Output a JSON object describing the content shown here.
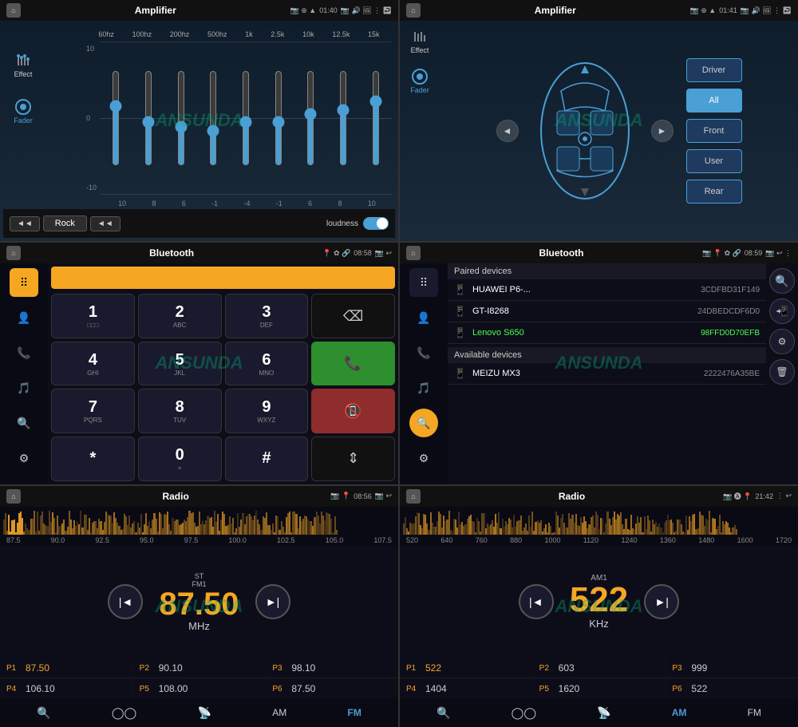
{
  "panels": {
    "eq": {
      "title": "Amplifier",
      "time": "01:40",
      "sidebar": {
        "effect_label": "Effect",
        "fader_label": "Fader"
      },
      "freq_labels": [
        "60hz",
        "100hz",
        "200hz",
        "500hz",
        "1k",
        "2.5k",
        "10k",
        "12.5k",
        "15k"
      ],
      "y_labels": [
        "10",
        "0",
        "-10"
      ],
      "x_labels": [
        "10",
        "8",
        "6",
        "-1",
        "-4",
        "-1",
        "6",
        "8",
        "10"
      ],
      "slider_values": [
        65,
        55,
        50,
        45,
        50,
        50,
        55,
        60,
        70
      ],
      "preset": "Rock",
      "loudness_label": "loudness",
      "prev_btn": "◄◄",
      "next_btn": "◄◄"
    },
    "fader": {
      "title": "Amplifier",
      "time": "01:41",
      "sidebar": {
        "effect_label": "Effect",
        "fader_label": "Fader"
      },
      "buttons": [
        "Driver",
        "All",
        "Front",
        "User",
        "Rear"
      ],
      "active_button": "All"
    },
    "bt_dialer": {
      "title": "Bluetooth",
      "time": "08:58",
      "keys": [
        {
          "num": "1",
          "alpha": "□□□"
        },
        {
          "num": "2",
          "alpha": "ABC"
        },
        {
          "num": "3",
          "alpha": "DEF"
        },
        {
          "num": "⌫",
          "alpha": "",
          "type": "dark"
        },
        {
          "num": "4",
          "alpha": "GHI"
        },
        {
          "num": "5",
          "alpha": "JKL"
        },
        {
          "num": "6",
          "alpha": "MNO"
        },
        {
          "num": "📞",
          "alpha": "",
          "type": "green"
        },
        {
          "num": "7",
          "alpha": "PQRS"
        },
        {
          "num": "8",
          "alpha": "TUV"
        },
        {
          "num": "9",
          "alpha": "WXYZ"
        },
        {
          "num": "📵",
          "alpha": "",
          "type": "red"
        },
        {
          "num": "*",
          "alpha": ""
        },
        {
          "num": "0",
          "alpha": "+"
        },
        {
          "num": "#",
          "alpha": ""
        },
        {
          "num": "⇕",
          "alpha": "",
          "type": "dark"
        }
      ]
    },
    "bt_devices": {
      "title": "Bluetooth",
      "time": "08:59",
      "paired_title": "Paired devices",
      "available_title": "Available devices",
      "paired": [
        {
          "name": "HUAWEI P6-...",
          "addr": "3CDFBD31F149",
          "highlight": false
        },
        {
          "name": "GT-I8268",
          "addr": "24DBEDCDF6D0",
          "highlight": false
        },
        {
          "name": "Lenovo S650",
          "addr": "98FFD0D70EFB",
          "highlight": true
        }
      ],
      "available": [
        {
          "name": "MEIZU MX3",
          "addr": "2222476A35BE",
          "highlight": false
        }
      ]
    },
    "radio_fm": {
      "title": "Radio",
      "time": "08:56",
      "band": "ST\nFM1",
      "freq": "87.50",
      "unit": "MHz",
      "scale_labels": [
        "87.5",
        "90.0",
        "92.5",
        "95.0",
        "97.5",
        "100.0",
        "102.5",
        "105.0",
        "107.5"
      ],
      "presets": [
        {
          "label": "P1",
          "freq": "87.50",
          "highlight": true
        },
        {
          "label": "P2",
          "freq": "90.10",
          "highlight": false
        },
        {
          "label": "P3",
          "freq": "98.10",
          "highlight": false
        },
        {
          "label": "P4",
          "freq": "106.10",
          "highlight": false
        },
        {
          "label": "P5",
          "freq": "108.00",
          "highlight": false
        },
        {
          "label": "P6",
          "freq": "87.50",
          "highlight": false
        }
      ],
      "bottom_btns": [
        "◎",
        "○○",
        "(•)",
        "AM",
        "FM"
      ]
    },
    "radio_am": {
      "title": "Radio",
      "time": "21:42",
      "band": "AM1",
      "freq": "522",
      "unit": "KHz",
      "scale_labels": [
        "520",
        "640",
        "760",
        "880",
        "1000",
        "1120",
        "1240",
        "1360",
        "1480",
        "1600",
        "1720"
      ],
      "presets": [
        {
          "label": "P1",
          "freq": "522",
          "highlight": true
        },
        {
          "label": "P2",
          "freq": "603",
          "highlight": false
        },
        {
          "label": "P3",
          "freq": "999",
          "highlight": false
        },
        {
          "label": "P4",
          "freq": "1404",
          "highlight": false
        },
        {
          "label": "P5",
          "freq": "1620",
          "highlight": false
        },
        {
          "label": "P6",
          "freq": "522",
          "highlight": false
        }
      ],
      "bottom_btns": [
        "◎",
        "○○",
        "(•)",
        "AM",
        "FM"
      ]
    }
  },
  "watermark": "ANSUNDA"
}
